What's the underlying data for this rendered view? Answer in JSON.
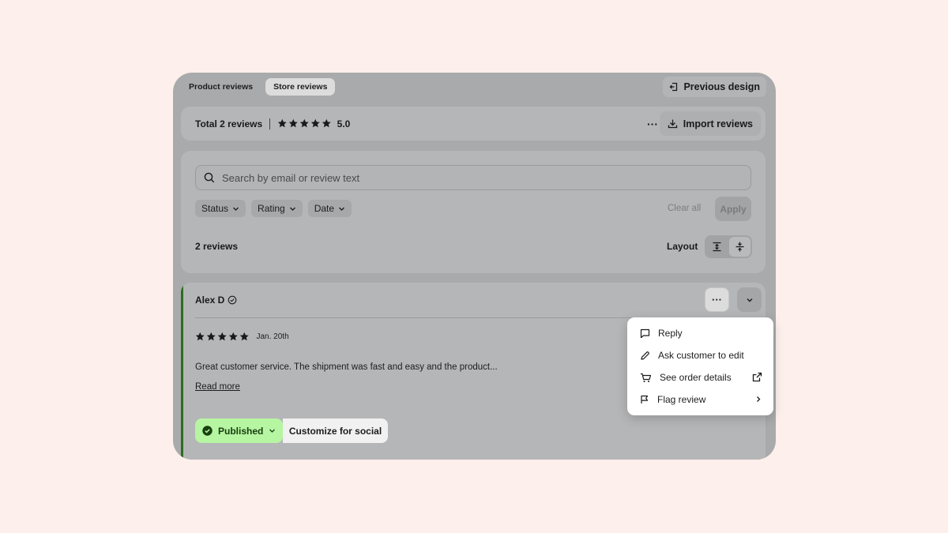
{
  "tabs": [
    {
      "label": "Product reviews",
      "active": false
    },
    {
      "label": "Store reviews",
      "active": true
    }
  ],
  "header": {
    "previous_design_label": "Previous design"
  },
  "summary": {
    "total_label": "Total 2 reviews",
    "average": "5.0",
    "rating_stars": 5,
    "more_label": "···",
    "import_label": "Import reviews"
  },
  "filters": {
    "search_placeholder": "Search by email or review text",
    "chips": [
      "Status",
      "Rating",
      "Date"
    ],
    "clear_all_label": "Clear all",
    "apply_label": "Apply",
    "count_label": "2 reviews",
    "layout_label": "Layout"
  },
  "review": {
    "author": "Alex D",
    "stars": 5,
    "date": "Jan. 20th",
    "text": "Great customer service. The shipment was fast and easy and the product...",
    "read_more_label": "Read more",
    "status_label": "Published",
    "social_label": "Customize for social",
    "more_label": "···"
  },
  "menu": {
    "items": [
      {
        "label": "Reply",
        "icon": "comment-icon"
      },
      {
        "label": "Ask customer to edit",
        "icon": "pencil-icon"
      },
      {
        "label": "See order details",
        "icon": "cart-icon"
      },
      {
        "label": "Flag review",
        "icon": "flag-icon"
      }
    ]
  },
  "colors": {
    "page_bg": "#fdefeb",
    "overlay": "#a9aaab",
    "published_bg": "#b6f5a2",
    "accent_green": "#2c6c22"
  }
}
